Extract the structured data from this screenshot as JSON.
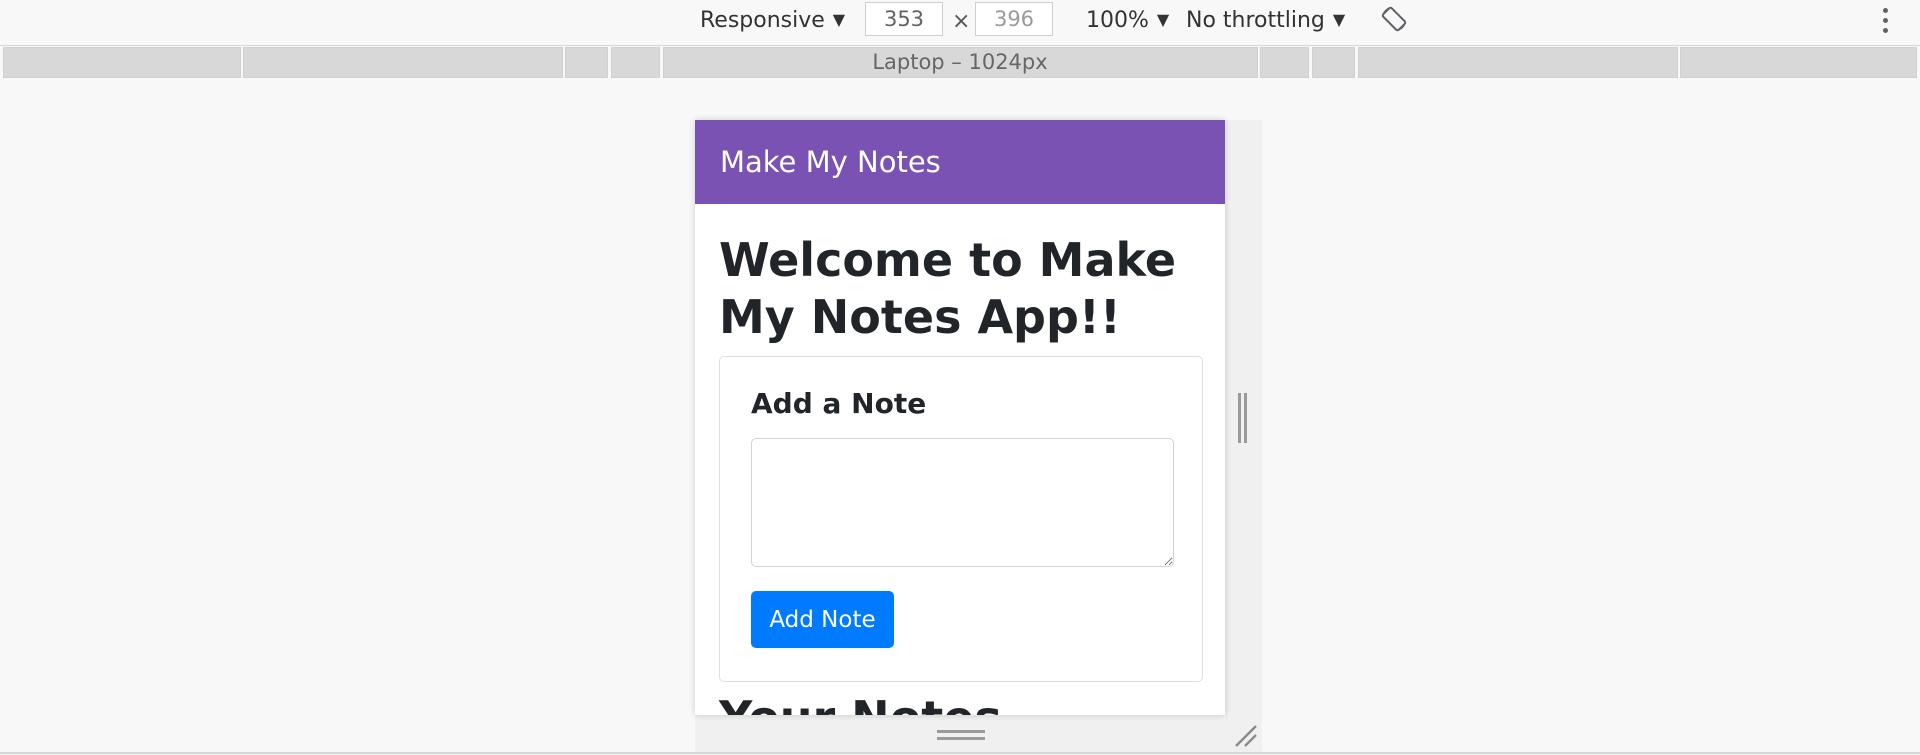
{
  "devtools": {
    "device_mode": "Responsive",
    "width_value": "353",
    "times_sign": "×",
    "height_value": "396",
    "zoom": "100%",
    "throttling": "No throttling",
    "rotate_icon": "rotate-icon",
    "menu_icon": "kebab-menu-icon",
    "breakpoint_label": "Laptop – 1024px"
  },
  "app": {
    "navbar_brand": "Make My Notes",
    "welcome_heading": "Welcome to Make My Notes App!!",
    "card_title": "Add a Note",
    "note_textarea_value": "",
    "add_button_label": "Add Note",
    "notes_heading": "Your Notes"
  },
  "colors": {
    "navbar": "#7952b3",
    "button": "#007bff"
  }
}
